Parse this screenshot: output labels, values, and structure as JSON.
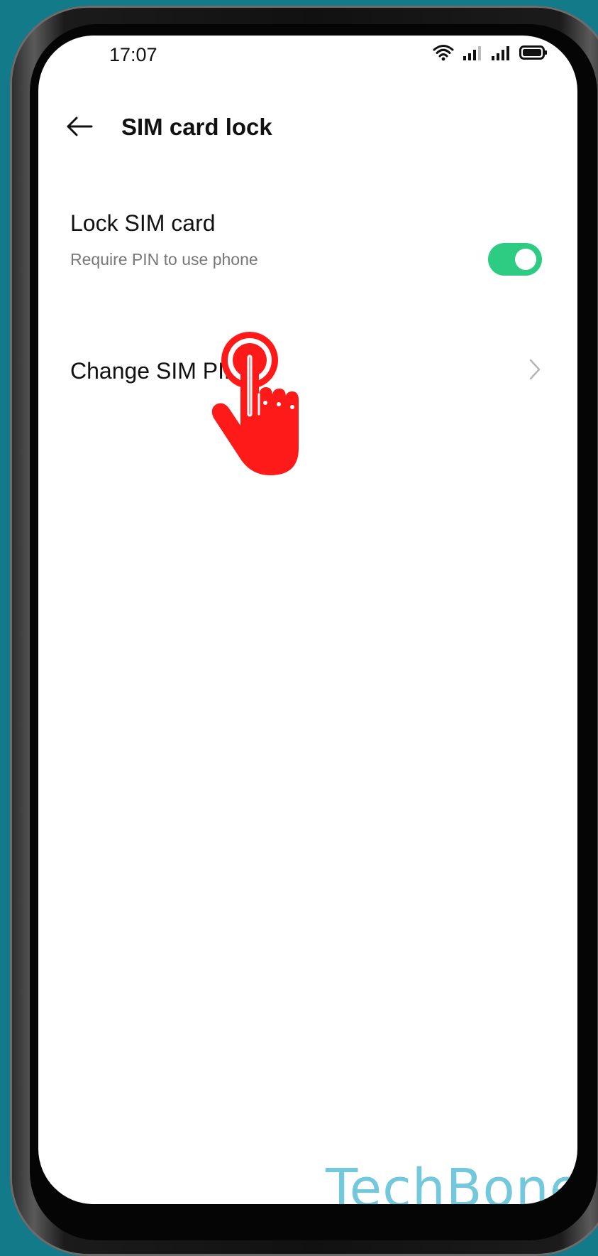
{
  "status_bar": {
    "time": "17:07",
    "icons": [
      "wifi-icon",
      "signal-icon",
      "signal-icon",
      "battery-icon"
    ]
  },
  "header": {
    "back_icon": "arrow-left-icon",
    "title": "SIM card lock"
  },
  "settings": {
    "lock_sim": {
      "title": "Lock SIM card",
      "subtitle": "Require PIN to use phone",
      "enabled": true,
      "toggle_color": "#2ecc82"
    },
    "change_pin": {
      "title": "Change SIM PIN",
      "chevron_icon": "chevron-right-icon"
    }
  },
  "overlay": {
    "tap_indicator_icon": "tap-hand-icon",
    "tap_color": "#ff1a1a"
  },
  "watermark": {
    "text": "TechBone",
    "color": "#5bbfd6"
  }
}
